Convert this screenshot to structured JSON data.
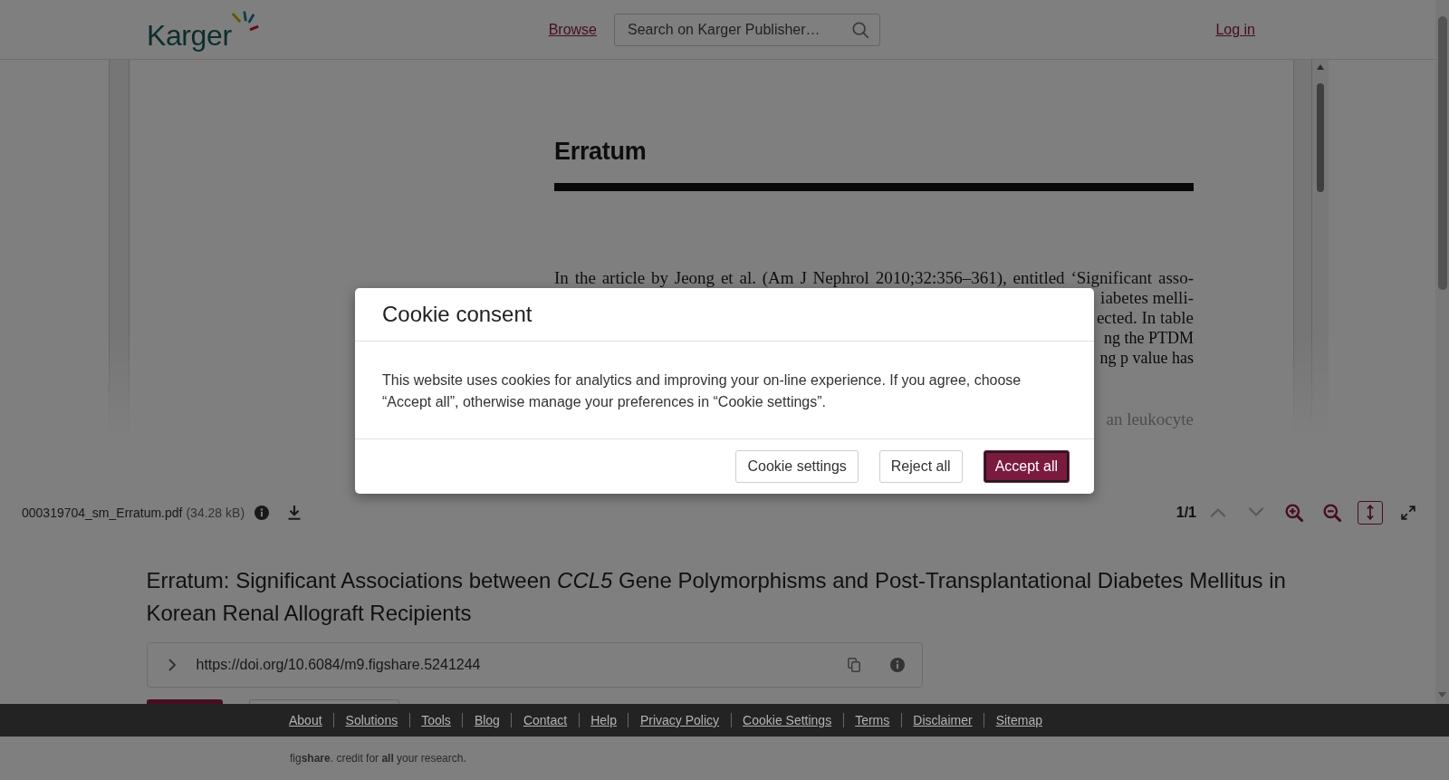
{
  "header": {
    "logo_text": "Karger",
    "nav_link": "Browse",
    "search": {
      "placeholder": "Search on Karger Publisher…"
    },
    "login_link": "Log in"
  },
  "pdf_viewer": {
    "page": {
      "heading": "Erratum",
      "lines": [
        {
          "kind": "full",
          "text": "In the article by Jeong et al. (Am J Nephrol 2010;32:356–361), entitled ‘Significant asso-"
        },
        {
          "kind": "fragment",
          "text": "iabetes melli-"
        },
        {
          "kind": "fragment",
          "text": "ected. In table"
        },
        {
          "kind": "blurred",
          "text": "ng the PTDM"
        },
        {
          "kind": "blurred",
          "text": "ng p value has"
        },
        {
          "kind": "faded",
          "text": "an leukocyte"
        }
      ]
    },
    "toolbar": {
      "file_name": "000319704_sm_Erratum.pdf",
      "file_size": "(34.28 kB)",
      "page_indicator": "1/1",
      "controls": [
        {
          "kind": "previous-page",
          "disabled": true,
          "on": false
        },
        {
          "kind": "next-page",
          "disabled": true,
          "on": false
        },
        {
          "kind": "zoom-in",
          "disabled": false,
          "on": false
        },
        {
          "kind": "zoom-out",
          "disabled": false,
          "on": false
        },
        {
          "kind": "fit-height",
          "disabled": false,
          "on": true
        },
        {
          "kind": "fullscreen",
          "disabled": false,
          "on": false
        }
      ]
    }
  },
  "record": {
    "title": "Erratum: Significant Associations between *CCL5* Gene Polymorphisms and Post-Transplantational Diabetes Mellitus in Korean Renal Allograft Recipients",
    "doi": "https://doi.org/10.6084/m9.figshare.5241244",
    "action_buttons": [
      {
        "kind": "primary"
      },
      {
        "kind": "secondary"
      }
    ]
  },
  "footer": {
    "links": [
      "About",
      "Solutions",
      "Tools",
      "Blog",
      "Contact",
      "Help",
      "Privacy Policy",
      "Cookie Settings",
      "Terms",
      "Disclaimer",
      "Sitemap"
    ],
    "credit": "fig**share**. credit for **all** your research."
  },
  "cookie_dialog": {
    "title": "Cookie consent",
    "message": "This website uses cookies for analytics and improving your on-line experience. If you agree, choose “Accept all”, otherwise manage your preferences in “Cookie settings”.",
    "buttons": [
      {
        "label": "Cookie settings",
        "kind": "secondary",
        "focused": false
      },
      {
        "label": "Reject all",
        "kind": "secondary",
        "focused": false
      },
      {
        "label": "Accept all",
        "kind": "primary",
        "focused": true
      }
    ]
  }
}
